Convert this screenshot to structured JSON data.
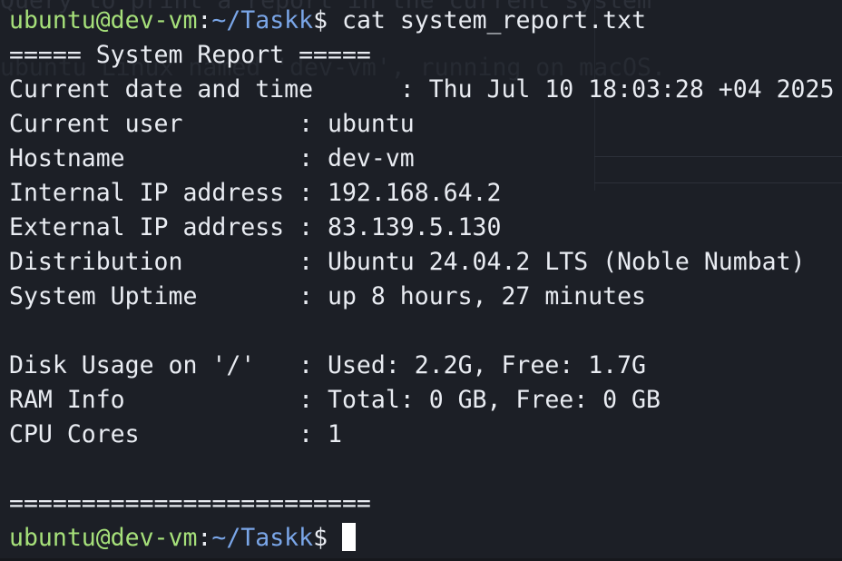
{
  "ghost_text": {
    "top": "Query to print a report in the current system",
    "middle": "ubuntu Linux named 'dev-vm', running on macOS."
  },
  "prompt": {
    "user_host": "ubuntu@dev-vm",
    "colon": ":",
    "path": "~/Taskk",
    "dollar": "$ ",
    "command": "cat system_report.txt"
  },
  "report": {
    "header": "===== System Report =====",
    "rows": [
      {
        "key": "Current date and time      ",
        "sep": ": ",
        "value": "Thu Jul 10 18:03:28 +04 2025"
      },
      {
        "key": "Current user        ",
        "sep": ": ",
        "value": "ubuntu"
      },
      {
        "key": "Hostname            ",
        "sep": ": ",
        "value": "dev-vm"
      },
      {
        "key": "Internal IP address ",
        "sep": ": ",
        "value": "192.168.64.2"
      },
      {
        "key": "External IP address ",
        "sep": ": ",
        "value": "83.139.5.130"
      },
      {
        "key": "Distribution        ",
        "sep": ": ",
        "value": "Ubuntu 24.04.2 LTS (Noble Numbat)"
      },
      {
        "key": "System Uptime       ",
        "sep": ": ",
        "value": "up 8 hours, 27 minutes"
      }
    ],
    "rows2": [
      {
        "key": "Disk Usage on '/'   ",
        "sep": ": ",
        "value": "Used: 2.2G, Free: 1.7G"
      },
      {
        "key": "RAM Info            ",
        "sep": ": ",
        "value": "Total: 0 GB, Free: 0 GB"
      },
      {
        "key": "CPU Cores           ",
        "sep": ": ",
        "value": "1"
      }
    ],
    "footer": "========================="
  },
  "prompt2": {
    "user_host": "ubuntu@dev-vm",
    "colon": ":",
    "path": "~/Taskk",
    "dollar": "$ "
  },
  "colors": {
    "background": "#1c1f26",
    "user_host": "#a6e07a",
    "path": "#7aa6e8",
    "text": "#e9ecf2"
  }
}
